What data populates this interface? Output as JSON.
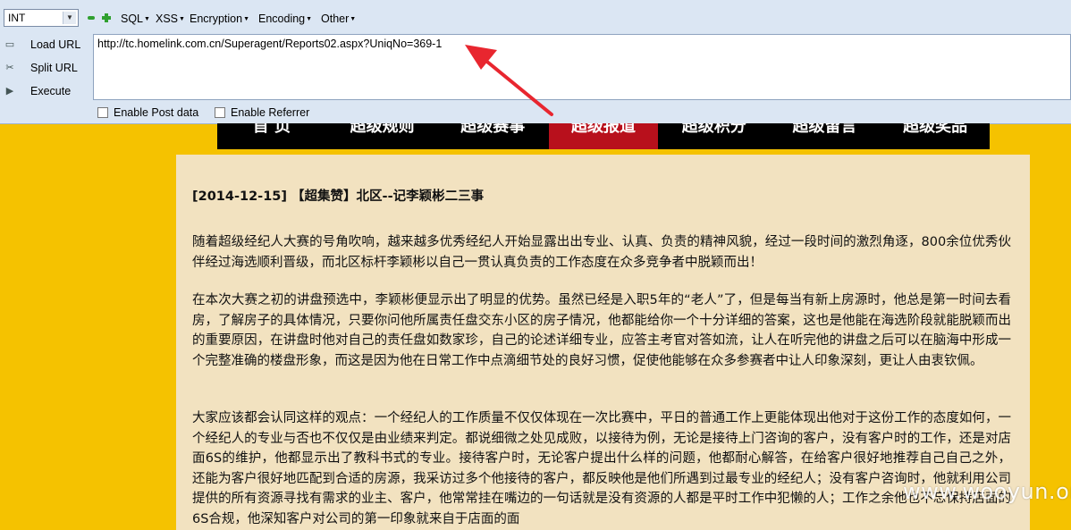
{
  "hackbar": {
    "type_select": "INT",
    "menus": [
      "SQL",
      "XSS",
      "Encryption",
      "Encoding",
      "Other"
    ],
    "commands": {
      "load_url": "Load URL",
      "split_url": "Split URL",
      "execute": "Execute"
    },
    "url_value": "http://tc.homelink.com.cn/Superagent/Reports02.aspx?UniqNo=369-1",
    "enable_post": "Enable Post data",
    "enable_referrer": "Enable Referrer",
    "checkboxes": {
      "enable_post": false,
      "enable_referrer": false
    }
  },
  "site_nav": {
    "tabs": [
      "首 页",
      "超级规则",
      "超级赛事",
      "超级报道",
      "超级积分",
      "超级留言",
      "超级奖品"
    ],
    "active_tab": "超级报道",
    "active_color": "#b8101c"
  },
  "article": {
    "title": "[2014-12-15] 【超集赞】北区--记李颖彬二三事",
    "paragraphs": [
      "随着超级经纪人大赛的号角吹响，越来越多优秀经纪人开始显露出出专业、认真、负责的精神风貌，经过一段时间的激烈角逐，800余位优秀伙伴经过海选顺利晋级，而北区标杆李颖彬以自己一贯认真负责的工作态度在众多竞争者中脱颖而出！",
      "在本次大赛之初的讲盘预选中，李颖彬便显示出了明显的优势。虽然已经是入职5年的“老人”了，但是每当有新上房源时，他总是第一时间去看房，了解房子的具体情况，只要你问他所属责任盘交东小区的房子情况，他都能给你一个十分详细的答案，这也是他能在海选阶段就能脱颖而出的重要原因，在讲盘时他对自己的责任盘如数家珍，自己的论述详细专业，应答主考官对答如流，让人在听完他的讲盘之后可以在脑海中形成一个完整准确的楼盘形象，而这是因为他在日常工作中点滴细节处的良好习惯，促使他能够在众多参赛者中让人印象深刻，更让人由衷钦佩。",
      "大家应该都会认同这样的观点：一个经纪人的工作质量不仅仅体现在一次比赛中，平日的普通工作上更能体现出他对于这份工作的态度如何，一个经纪人的专业与否也不仅仅是由业绩来判定。都说细微之处见成败，以接待为例，无论是接待上门咨询的客户，没有客户时的工作，还是对店面6S的维护，他都显示出了教科书式的专业。接待客户时，无论客户提出什么样的问题，他都耐心解答，在给客户很好地推荐自己自己之外，还能为客户很好地匹配到合适的房源，我采访过多个他接待的客户，都反映他是他们所遇到过最专业的经纪人；没有客户咨询时，他就利用公司提供的所有资源寻找有需求的业主、客户，他常常挂在嘴边的一句话就是没有资源的人都是平时工作中犯懒的人；工作之余他也不忘保持店面的6S合规，他深知客户对公司的第一印象就来自于店面的面"
    ]
  },
  "watermark": "www.wooyun.org",
  "colors": {
    "page_background": "#f5c200",
    "toolbar_background": "#dbe6f3",
    "article_background": "#f2e2c0",
    "annotation_arrow": "#e8262f"
  }
}
